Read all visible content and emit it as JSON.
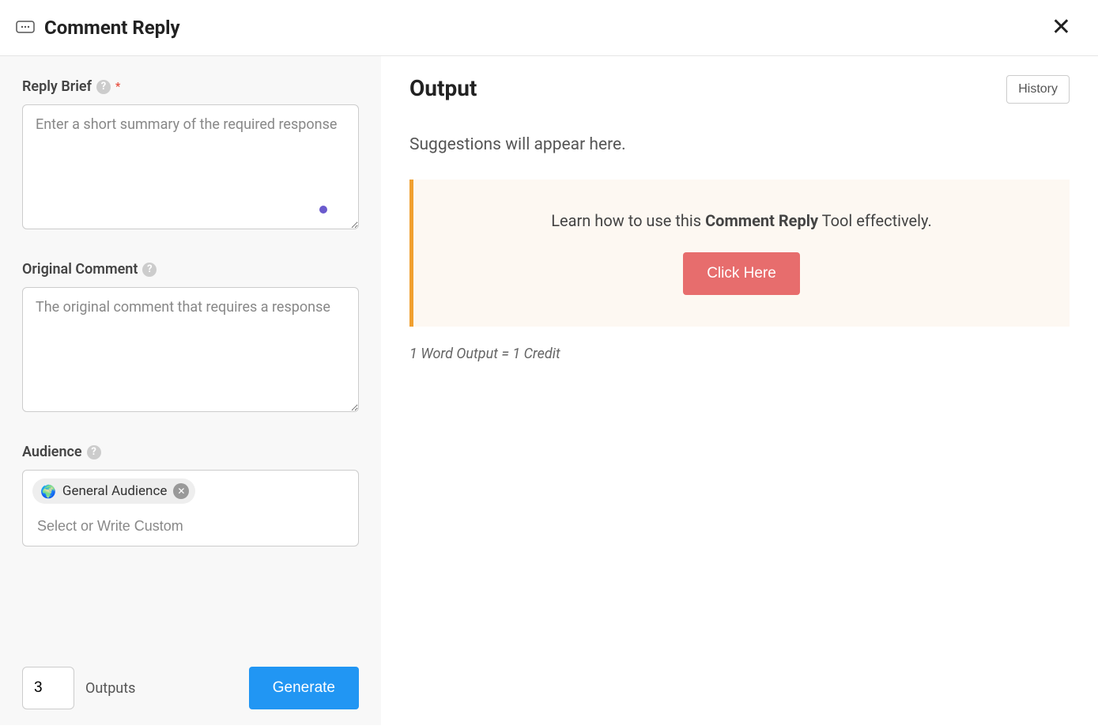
{
  "header": {
    "title": "Comment Reply"
  },
  "form": {
    "reply_brief": {
      "label": "Reply Brief",
      "placeholder": "Enter a short summary of the required response",
      "value": ""
    },
    "original_comment": {
      "label": "Original Comment",
      "placeholder": "The original comment that requires a response",
      "value": ""
    },
    "audience": {
      "label": "Audience",
      "tag_emoji": "🌍",
      "tag_text": "General Audience",
      "placeholder": "Select or Write Custom"
    },
    "footer": {
      "outputs_value": "3",
      "outputs_label": "Outputs",
      "generate_label": "Generate"
    }
  },
  "output": {
    "title": "Output",
    "history_label": "History",
    "suggestions_text": "Suggestions will appear here.",
    "learn_prefix": "Learn how to use this ",
    "learn_bold": "Comment Reply",
    "learn_suffix": " Tool effectively.",
    "click_here_label": "Click Here",
    "credit_text": "1 Word Output = 1 Credit"
  }
}
